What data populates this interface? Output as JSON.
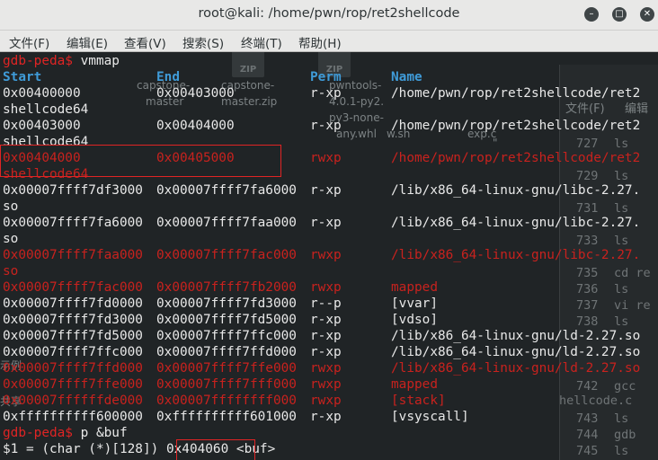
{
  "window": {
    "title": "root@kali: /home/pwn/rop/ret2shellcode",
    "minimize_icon": "minimize-icon",
    "maximize_icon": "maximize-icon",
    "close_icon": "close-icon"
  },
  "menu": [
    "文件(F)",
    "编辑(E)",
    "查看(V)",
    "搜索(S)",
    "终端(T)",
    "帮助(H)"
  ],
  "background": {
    "desktop_labels": [
      "capstone-",
      "master",
      "capstone-",
      "master.zip",
      "pwntools-",
      "4.0.1-py2.",
      "py3-none-",
      "any.whl",
      "ZIP",
      "ZIP"
    ],
    "side_window_header": [
      "文件(F)",
      "编辑"
    ],
    "history_numbers": [
      "727",
      "729",
      "731",
      "733",
      "735",
      "736",
      "737",
      "738",
      "742",
      "743",
      "744",
      "745"
    ],
    "history_cmds": [
      "ls",
      "ls",
      "ls",
      "ls",
      "cd re",
      "ls",
      "vi re",
      "ls",
      "gcc",
      "ls",
      "gdb",
      "ls"
    ],
    "fragments": [
      "hellcode.c",
      "w.sh",
      "exp.c",
      "示例",
      "共享",
      "\"",
      "件"
    ]
  },
  "terminal": {
    "prompt": "gdb-peda$",
    "cmd1": " vmmap",
    "headers": {
      "start": "Start",
      "end": "End",
      "perm": "Perm",
      "name": "Name"
    },
    "rows": [
      {
        "start": "0x00400000",
        "end": "0x00403000",
        "perm": "r-xp",
        "name": "/home/pwn/rop/ret2shellcode/ret2",
        "wrap": "shellcode64",
        "style": "normal"
      },
      {
        "start": "0x00403000",
        "end": "0x00404000",
        "perm": "r-xp",
        "name": "/home/pwn/rop/ret2shellcode/ret2",
        "wrap": "shellcode64",
        "style": "normal"
      },
      {
        "start": "0x00404000",
        "end": "0x00405000",
        "perm": "rwxp",
        "name": "/home/pwn/rop/ret2shellcode/ret2",
        "wrap": "shellcode64",
        "style": "red"
      },
      {
        "start": "0x00007ffff7df3000",
        "end": "0x00007ffff7fa6000",
        "perm": "r-xp",
        "name": "/lib/x86_64-linux-gnu/libc-2.27.",
        "wrap": "so",
        "style": "normal"
      },
      {
        "start": "0x00007ffff7fa6000",
        "end": "0x00007ffff7faa000",
        "perm": "r-xp",
        "name": "/lib/x86_64-linux-gnu/libc-2.27.",
        "wrap": "so",
        "style": "normal"
      },
      {
        "start": "0x00007ffff7faa000",
        "end": "0x00007ffff7fac000",
        "perm": "rwxp",
        "name": "/lib/x86_64-linux-gnu/libc-2.27.",
        "wrap": "so",
        "style": "red"
      },
      {
        "start": "0x00007ffff7fac000",
        "end": "0x00007ffff7fb2000",
        "perm": "rwxp",
        "name": "mapped",
        "style": "red"
      },
      {
        "start": "0x00007ffff7fd0000",
        "end": "0x00007ffff7fd3000",
        "perm": "r--p",
        "name": "[vvar]",
        "style": "normal"
      },
      {
        "start": "0x00007ffff7fd3000",
        "end": "0x00007ffff7fd5000",
        "perm": "r-xp",
        "name": "[vdso]",
        "style": "normal"
      },
      {
        "start": "0x00007ffff7fd5000",
        "end": "0x00007ffff7ffc000",
        "perm": "r-xp",
        "name": "/lib/x86_64-linux-gnu/ld-2.27.so",
        "style": "normal"
      },
      {
        "start": "0x00007ffff7ffc000",
        "end": "0x00007ffff7ffd000",
        "perm": "r-xp",
        "name": "/lib/x86_64-linux-gnu/ld-2.27.so",
        "style": "normal"
      },
      {
        "start": "0x00007ffff7ffd000",
        "end": "0x00007ffff7ffe000",
        "perm": "rwxp",
        "name": "/lib/x86_64-linux-gnu/ld-2.27.so",
        "style": "red"
      },
      {
        "start": "0x00007ffff7ffe000",
        "end": "0x00007ffff7fff000",
        "perm": "rwxp",
        "name": "mapped",
        "style": "red"
      },
      {
        "start": "0x00007ffffffde000",
        "end": "0x00007ffffffff000",
        "perm": "rwxp",
        "name": "[stack]",
        "style": "red"
      },
      {
        "start": "0xffffffffff600000",
        "end": "0xffffffffff601000",
        "perm": "r-xp",
        "name": "[vsyscall]",
        "style": "normal"
      }
    ],
    "cmd2": " p &buf",
    "result_prefix": "$1 = (char (*)[128]) ",
    "result_addr": "0x404060",
    "result_suffix": " <buf>"
  },
  "colors": {
    "highlight_box": "#e02424",
    "prompt": "#e02424",
    "rwx_text": "#c8221e",
    "header": "#3f9bd8"
  }
}
